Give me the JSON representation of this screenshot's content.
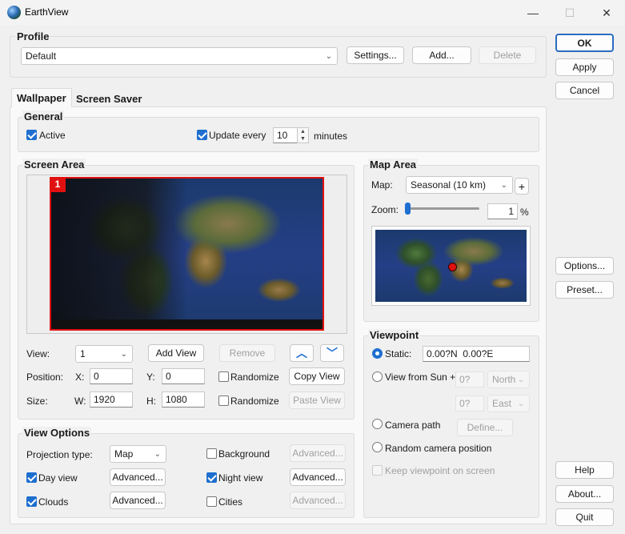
{
  "window": {
    "title": "EarthView",
    "minimize": "—",
    "maximize": "☐",
    "close": "✕"
  },
  "profile": {
    "title": "Profile",
    "selected": "Default",
    "settings_label": "Settings...",
    "add_label": "Add...",
    "delete_label": "Delete"
  },
  "right_buttons": {
    "ok": "OK",
    "apply": "Apply",
    "cancel": "Cancel",
    "options": "Options...",
    "preset": "Preset...",
    "help": "Help",
    "about": "About...",
    "quit": "Quit"
  },
  "tabs": [
    {
      "label": "Wallpaper",
      "active": true
    },
    {
      "label": "Screen Saver",
      "active": false
    }
  ],
  "general": {
    "title": "General",
    "active_label": "Active",
    "active_checked": true,
    "update_label": "Update every",
    "update_checked": true,
    "update_value": "10",
    "minutes_label": "minutes"
  },
  "screen_area": {
    "title": "Screen Area",
    "monitor_number": "1",
    "view_label": "View:",
    "view_value": "1",
    "add_view": "Add View",
    "remove": "Remove",
    "up_icon": "︿",
    "down_icon": "﹀",
    "position_label": "Position:",
    "x_label": "X:",
    "x_value": "0",
    "y_label": "Y:",
    "y_value": "0",
    "randomize_label": "Randomize",
    "copy_view": "Copy View",
    "size_label": "Size:",
    "w_label": "W:",
    "w_value": "1920",
    "h_label": "H:",
    "h_value": "1080",
    "randomize2_label": "Randomize",
    "paste_view": "Paste View"
  },
  "map_area": {
    "title": "Map Area",
    "map_label": "Map:",
    "map_value": "Seasonal (10 km)",
    "plus": "+",
    "zoom_label": "Zoom:",
    "zoom_value": "1",
    "zoom_unit": "%"
  },
  "viewpoint": {
    "title": "Viewpoint",
    "static_label": "Static:",
    "static_value": "0.00?N  0.00?E",
    "sun_label": "View from Sun +",
    "sun_deg1": "0?",
    "sun_dir1": "North",
    "sun_deg2": "0?",
    "sun_dir2": "East",
    "camera_label": "Camera path",
    "define_label": "Define...",
    "random_label": "Random camera position",
    "keep_label": "Keep viewpoint on screen"
  },
  "view_options": {
    "title": "View Options",
    "projection_label": "Projection type:",
    "projection_value": "Map",
    "background_label": "Background",
    "background_adv": "Advanced...",
    "dayview_label": "Day view",
    "dayview_adv": "Advanced...",
    "nightview_label": "Night view",
    "nightview_adv": "Advanced...",
    "clouds_label": "Clouds",
    "clouds_adv": "Advanced...",
    "cities_label": "Cities",
    "cities_adv": "Advanced..."
  },
  "icons": {
    "combo_arrow": "⌄"
  },
  "colors": {
    "accent": "#1e6fd0",
    "monitor_border": "#e01010",
    "location_marker": "#e01010"
  }
}
